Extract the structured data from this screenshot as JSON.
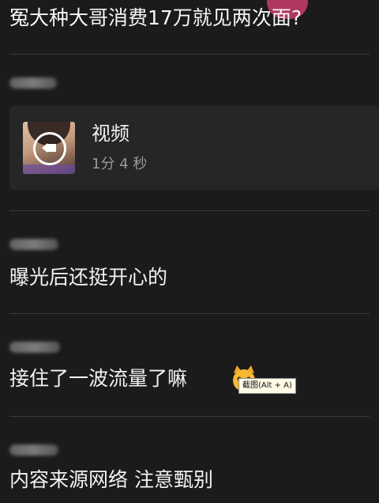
{
  "post": {
    "title": "冤大种大哥消费17万就见两次面?"
  },
  "video": {
    "title": "视频",
    "duration": "1分 4 秒",
    "play_icon": "video-play-icon"
  },
  "comments": [
    {
      "text": "曝光后还挺开心的"
    },
    {
      "text": "接住了一波流量了嘛"
    },
    {
      "text": "内容来源网络 注意甄别"
    }
  ],
  "tooltip": {
    "text": "截图(Alt + A)"
  },
  "colors": {
    "background": "#1b1b1b",
    "card": "#262626",
    "text": "#f2f2f2",
    "muted": "#9a9a9a"
  }
}
